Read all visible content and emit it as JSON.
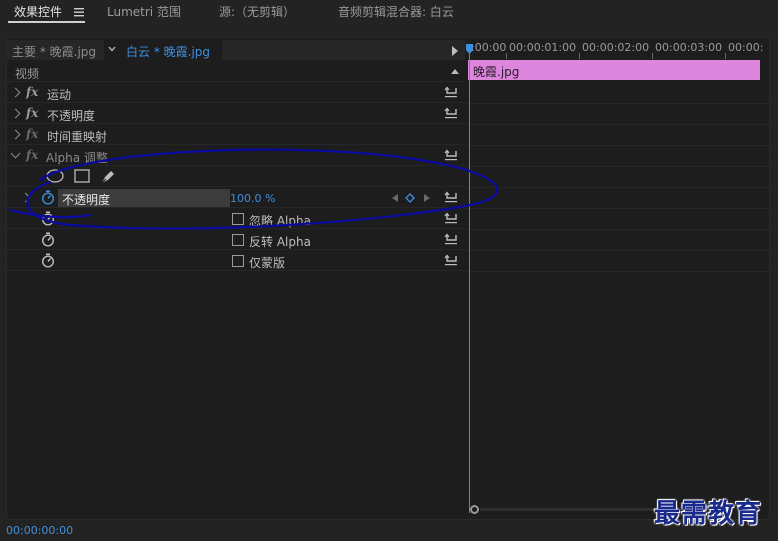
{
  "tabs": [
    {
      "label": "效果控件",
      "active": true
    },
    {
      "label": "Lumetri 范围",
      "active": false
    },
    {
      "label": "源:（无剪辑）",
      "active": false
    },
    {
      "label": "音频剪辑混合器: 白云",
      "active": false
    }
  ],
  "tab_menu_icon": "hamburger-icon",
  "clip_header": {
    "master": "主要 * 晚霞.jpg",
    "sequence": "白云 * 晚霞.jpg"
  },
  "section_label": "视频",
  "effects": [
    {
      "name": "运动",
      "fx_enabled": true
    },
    {
      "name": "不透明度",
      "fx_enabled": true
    },
    {
      "name": "时间重映射",
      "fx_enabled": false
    },
    {
      "name": "Alpha 调整",
      "fx_enabled": true
    }
  ],
  "mask_tools": [
    "ellipse-mask-icon",
    "rectangle-mask-icon",
    "pen-mask-icon"
  ],
  "alpha_properties": {
    "opacity_name": "不透明度",
    "opacity_value": "100.0 %",
    "ignore_alpha": "忽略 Alpha",
    "invert_alpha": "反转 Alpha",
    "mask_only": "仅蒙版"
  },
  "timecode": "00:00:00:00",
  "ruler_labels": [
    ":00:00",
    "00:00:01:00",
    "00:00:02:00",
    "00:00:03:00",
    "00:00:"
  ],
  "timeline_clip": "晚霞.jpg",
  "colors": {
    "accent": "#3f8fde",
    "clip": "#dd86dd",
    "annotation": "#0a0aa0",
    "watermark": "#1a2a8a"
  },
  "watermark": "最需教育"
}
